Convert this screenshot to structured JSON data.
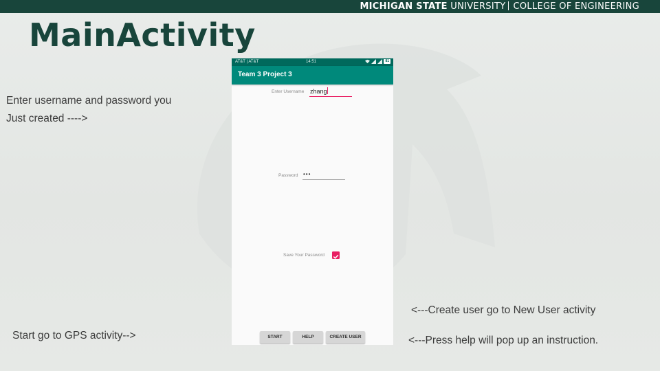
{
  "header": {
    "university": "MICHIGAN STATE",
    "university_rest": "UNIVERSITY",
    "college": "COLLEGE OF ENGINEERING"
  },
  "slide": {
    "title": "MainActivity",
    "notes": {
      "left_line1": "Enter username and password you",
      "left_line2": "Just created ---->",
      "start": "Start go to GPS activity-->",
      "create_user": "<---Create user  go to New User activity",
      "help": "<---Press help will pop up an instruction."
    }
  },
  "phone": {
    "status_bar": {
      "carrier": "AT&T | AT&T",
      "time": "14:51",
      "battery": "81"
    },
    "app_title": "Team 3 Project 3",
    "username": {
      "label": "Enter Username",
      "value": "zhang"
    },
    "password": {
      "label": "Password",
      "value": "•••"
    },
    "save_password": {
      "label": "Save Your Password",
      "checked": true
    },
    "buttons": {
      "start": "START",
      "help": "HELP",
      "create_user": "CREATE USER"
    },
    "colors": {
      "primary": "#00897b",
      "primary_dark": "#00695c",
      "accent": "#e91e63"
    }
  },
  "colors": {
    "msu_green": "#18453b"
  }
}
